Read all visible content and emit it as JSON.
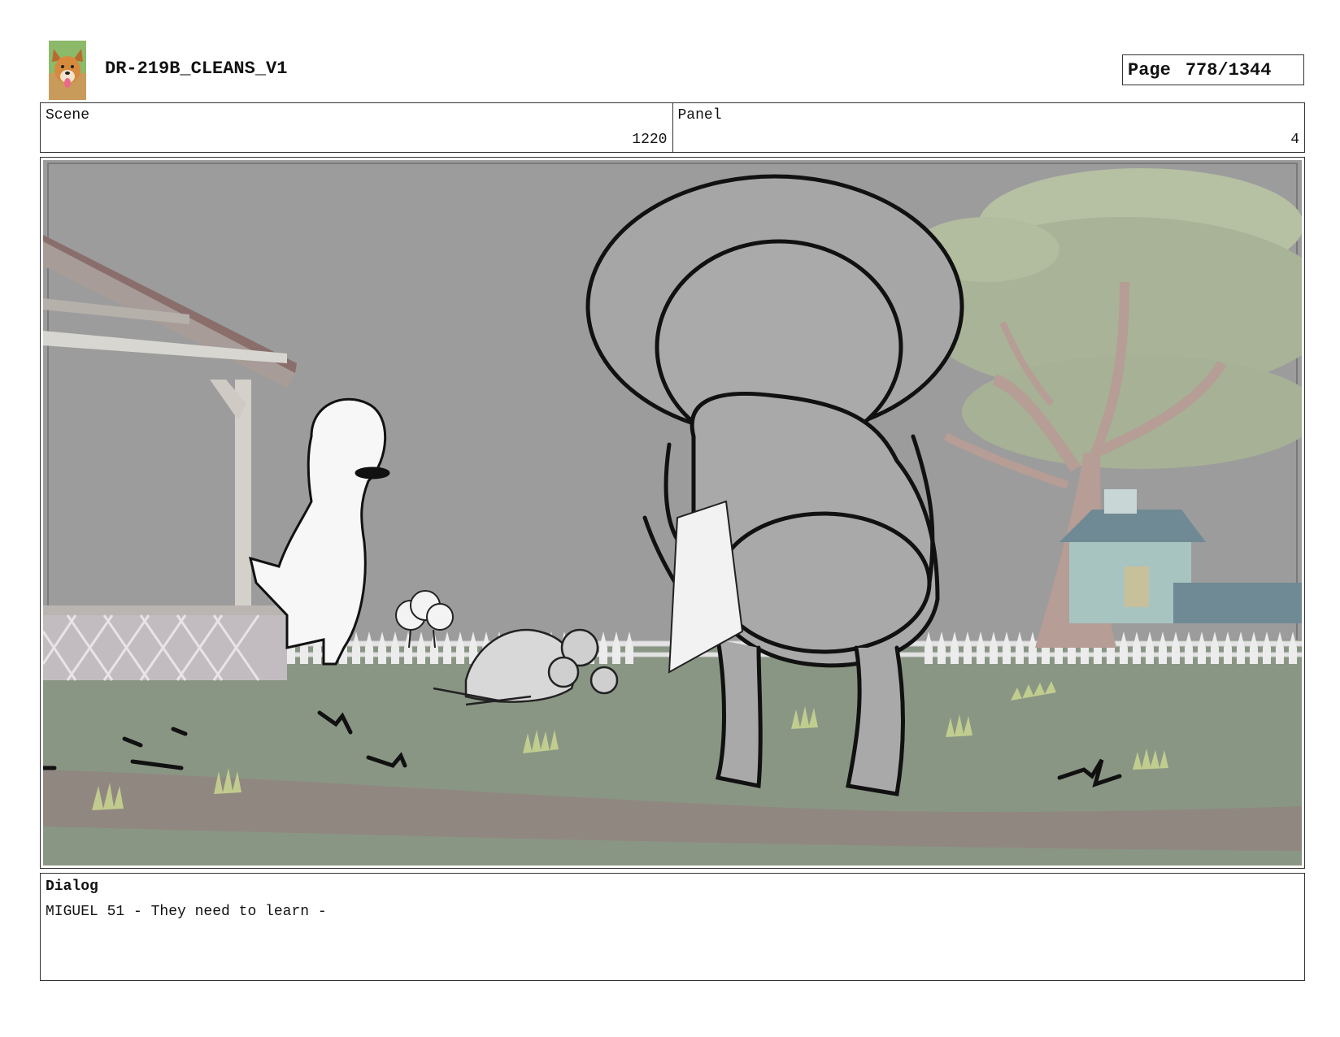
{
  "header": {
    "title": "DR-219B_CLEANS_V1",
    "page_label": "Page",
    "page_value": "778/1344",
    "logo_icon": "dog-photo-icon"
  },
  "info": {
    "scene_label": "Scene",
    "scene_value": "1220",
    "panel_label": "Panel",
    "panel_value": "4"
  },
  "panel_image": {
    "description_icon": "storyboard-sketch-icon"
  },
  "dialog": {
    "label": "Dialog",
    "text": "MIGUEL 51 - They need to learn -"
  }
}
